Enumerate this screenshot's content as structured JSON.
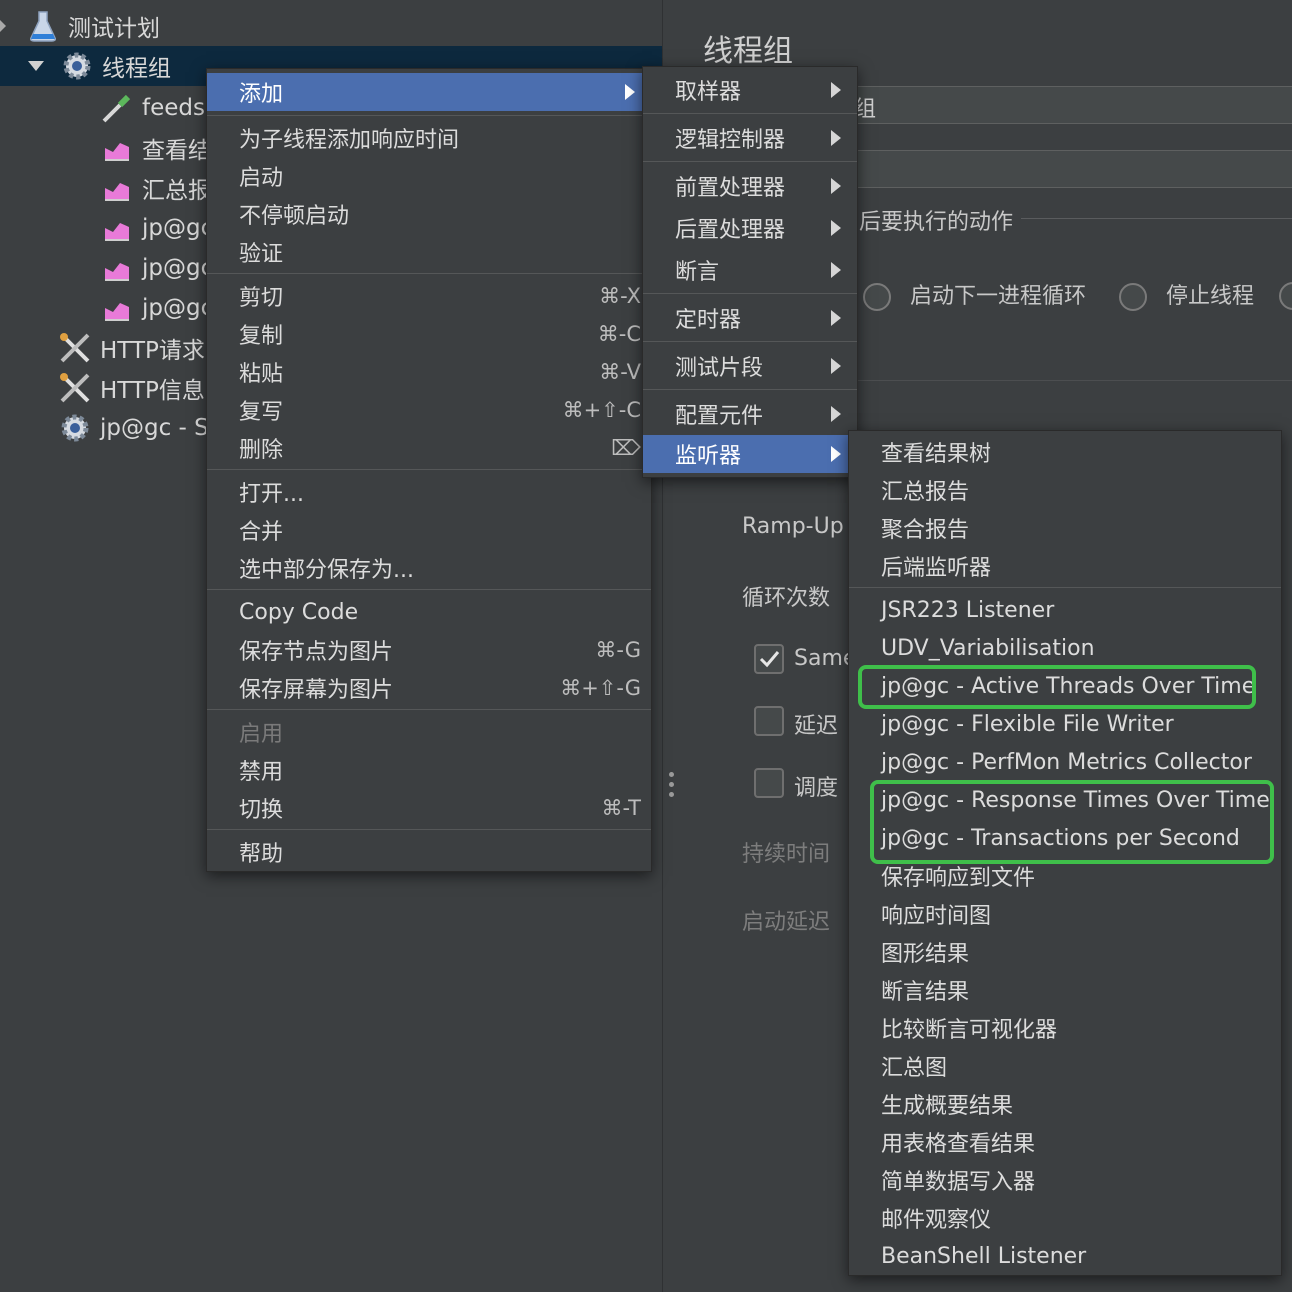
{
  "tree": {
    "test_plan": "测试计划",
    "thread_group": "线程组",
    "children": [
      "feeds",
      "查看结",
      "汇总报",
      "jp@gc",
      "jp@gc",
      "jp@gc"
    ],
    "http_request": "HTTP请求",
    "http_info": "HTTP信息",
    "jpgc_s": "jp@gc - S"
  },
  "panel": {
    "title": "线程组",
    "name_tail": "组",
    "action_label": "后要执行的动作",
    "radio_next_loop": "启动下一进程循环",
    "radio_stop_thread": "停止线程",
    "rampup_label": "Ramp-Up",
    "loop_label": "循环次数",
    "same_label": "Same",
    "delay_label": "延迟",
    "scheduler_label": "调度",
    "duration_label": "持续时间",
    "startup_delay_label": "启动延迟"
  },
  "context_menu": {
    "add": "添加",
    "add_response_time": "为子线程添加响应时间",
    "start": "启动",
    "start_no_pause": "不停顿启动",
    "validate": "验证",
    "cut": "剪切",
    "cut_sc": "⌘-X",
    "copy": "复制",
    "copy_sc": "⌘-C",
    "paste": "粘贴",
    "paste_sc": "⌘-V",
    "duplicate": "复写",
    "duplicate_sc": "⌘+⇧-C",
    "delete": "删除",
    "delete_sc": "⌦",
    "open": "打开...",
    "merge": "合并",
    "save_selection": "选中部分保存为...",
    "copy_code": "Copy Code",
    "save_node_image": "保存节点为图片",
    "save_node_image_sc": "⌘-G",
    "save_screen_image": "保存屏幕为图片",
    "save_screen_image_sc": "⌘+⇧-G",
    "enable": "启用",
    "disable": "禁用",
    "toggle": "切换",
    "toggle_sc": "⌘-T",
    "help": "帮助"
  },
  "add_submenu": {
    "sampler": "取样器",
    "logic_controller": "逻辑控制器",
    "pre_processor": "前置处理器",
    "post_processor": "后置处理器",
    "assertion": "断言",
    "timer": "定时器",
    "test_fragment": "测试片段",
    "config_element": "配置元件",
    "listener": "监听器"
  },
  "listener_submenu": {
    "items": [
      "查看结果树",
      "汇总报告",
      "聚合报告",
      "后端监听器",
      "JSR223 Listener",
      "UDV_Variabilisation",
      "jp@gc - Active Threads Over Time",
      "jp@gc - Flexible File Writer",
      "jp@gc - PerfMon Metrics Collector",
      "jp@gc - Response Times Over Time",
      "jp@gc - Transactions per Second",
      "保存响应到文件",
      "响应时间图",
      "图形结果",
      "断言结果",
      "比较断言可视化器",
      "汇总图",
      "生成概要结果",
      "用表格查看结果",
      "简单数据写入器",
      "邮件观察仪",
      "BeanShell Listener"
    ]
  },
  "colors": {
    "highlight": "#4b6eaf",
    "annotation": "#3fbf4a",
    "selected_tree_row": "#0d293e"
  }
}
